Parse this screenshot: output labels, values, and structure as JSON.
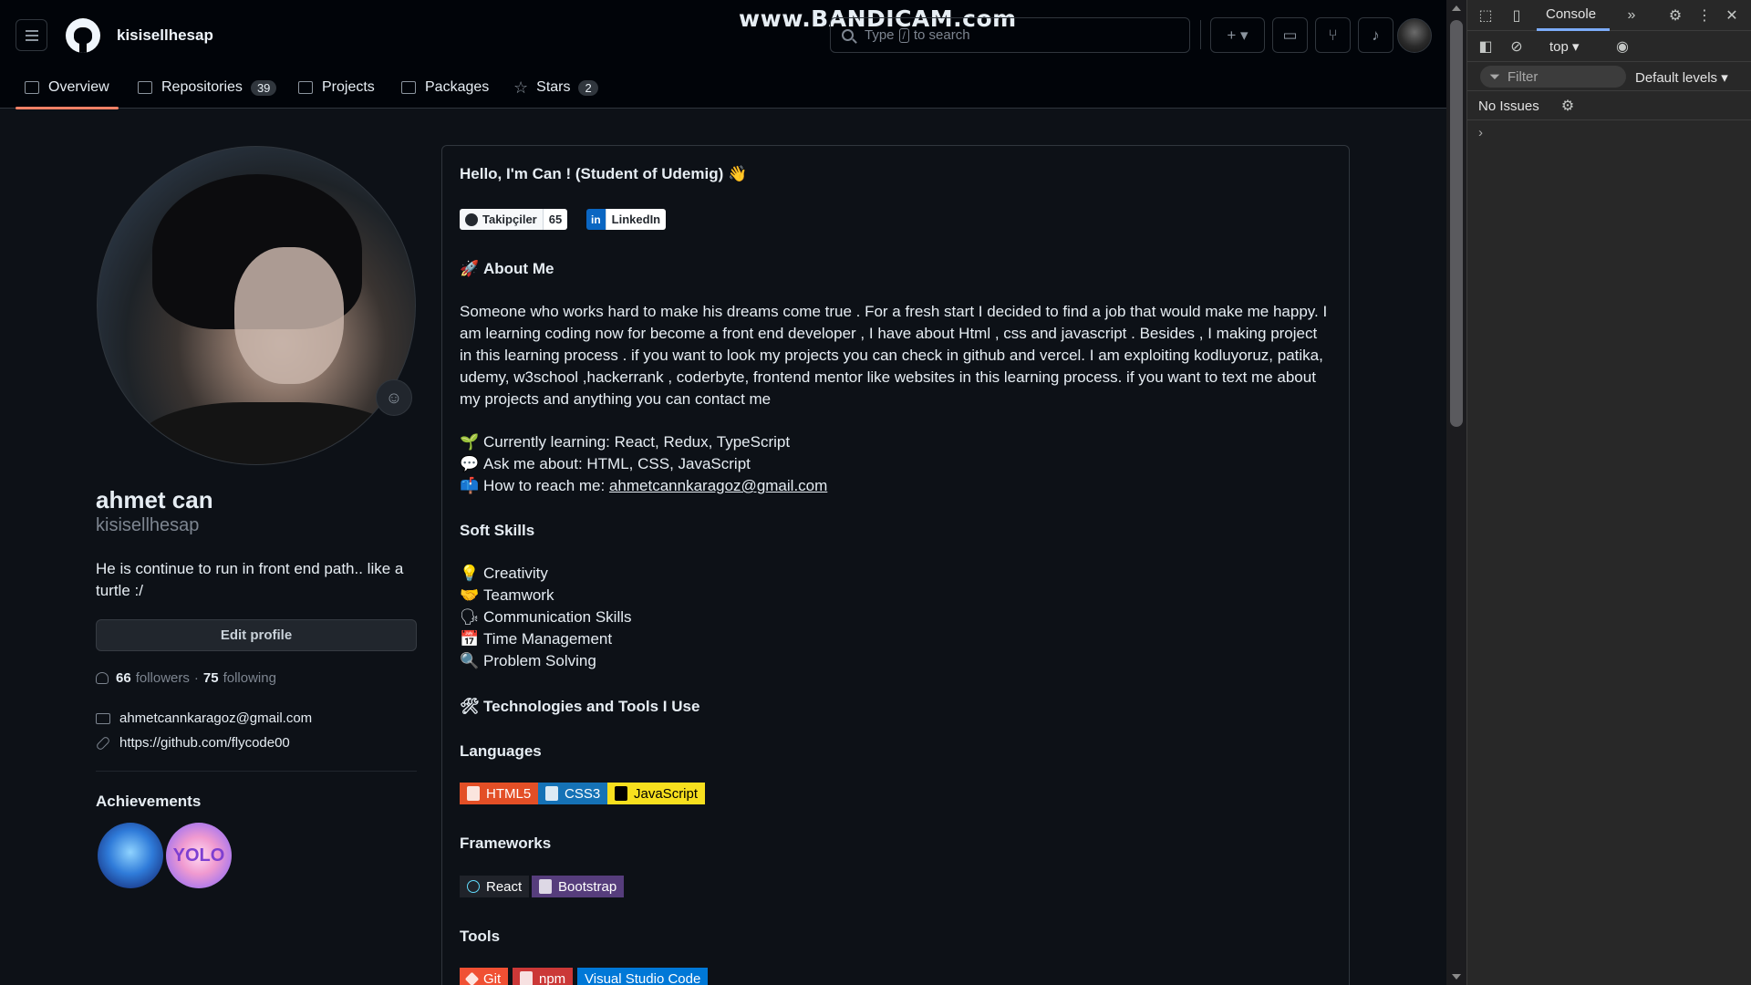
{
  "watermark": "www.BANDICAM.com",
  "header": {
    "username": "kisisellhesap",
    "search_placeholder_pre": "Type",
    "search_key": "/",
    "search_placeholder_post": "to search",
    "plus_label": "+ ▾"
  },
  "tabs": [
    {
      "label": "Overview",
      "count": ""
    },
    {
      "label": "Repositories",
      "count": "39"
    },
    {
      "label": "Projects",
      "count": ""
    },
    {
      "label": "Packages",
      "count": ""
    },
    {
      "label": "Stars",
      "count": "2"
    }
  ],
  "profile": {
    "fullname": "ahmet can",
    "login": "kisisellhesap",
    "bio": "He is continue to run in front end path.. like a turtle :/",
    "edit_label": "Edit profile",
    "followers_count": "66",
    "followers_label": "followers",
    "dot": "·",
    "following_count": "75",
    "following_label": "following",
    "email": "ahmetcannkaragoz@gmail.com",
    "link": "https://github.com/flycode00",
    "achievements_title": "Achievements",
    "achievement_2_text": "YOLO"
  },
  "readme": {
    "hello": "Hello, I'm Can ! (Student of Udemig) 👋",
    "shield_github_label": "Takipçiler",
    "shield_github_value": "65",
    "shield_linkedin_icon": "in",
    "shield_linkedin_label": "LinkedIn",
    "about_title": "About Me",
    "about_icon": "🚀",
    "about_text": "Someone who works hard to make his dreams come true . For a fresh start I decided to find a job that would make me happy. I am learning coding now for become a front end developer , I have about Html , css and javascript . Besides , I making project in this learning process . if you want to look my projects you can check in github and vercel. I am exploiting kodluyoruz, patika, udemy, w3school ,hackerrank , coderbyte, frontend mentor like websites in this learning process. if you want to text me about my projects and anything you can contact me",
    "learning_icon": "🌱",
    "learning": "Currently learning: React, Redux, TypeScript",
    "ask_icon": "💬",
    "ask": "Ask me about: HTML, CSS, JavaScript",
    "reach_icon": "📫",
    "reach_label": "How to reach me:",
    "reach_email": "ahmetcannkaragoz@gmail.com",
    "soft_title": "Soft Skills",
    "soft_skills": [
      {
        "icon": "💡",
        "label": "Creativity"
      },
      {
        "icon": "🤝",
        "label": "Teamwork"
      },
      {
        "icon": "🗣",
        "label": "Communication Skills"
      },
      {
        "icon": "📅",
        "label": "Time Management"
      },
      {
        "icon": "🔍",
        "label": "Problem Solving"
      }
    ],
    "tech_icon": "🛠",
    "tech_title": "Technologies and Tools I Use",
    "languages_title": "Languages",
    "languages": [
      "HTML5",
      "CSS3",
      "JavaScript"
    ],
    "frameworks_title": "Frameworks",
    "frameworks": [
      "React",
      "Bootstrap"
    ],
    "tools_title": "Tools",
    "tools": [
      "Git",
      "npm",
      "Visual Studio Code"
    ]
  },
  "devtools": {
    "console_tab": "Console",
    "context": "top ▾",
    "filter_placeholder": "Filter",
    "levels": "Default levels ▾",
    "issues": "No Issues",
    "prompt": "›"
  },
  "colors": {
    "html5": "#e34f26",
    "css3": "#1572b6",
    "javascript": "#f7df1e",
    "react": "#20232a",
    "bootstrap": "#563d7c",
    "git": "#f05033",
    "npm": "#cb3837",
    "vscode": "#0078d7"
  }
}
